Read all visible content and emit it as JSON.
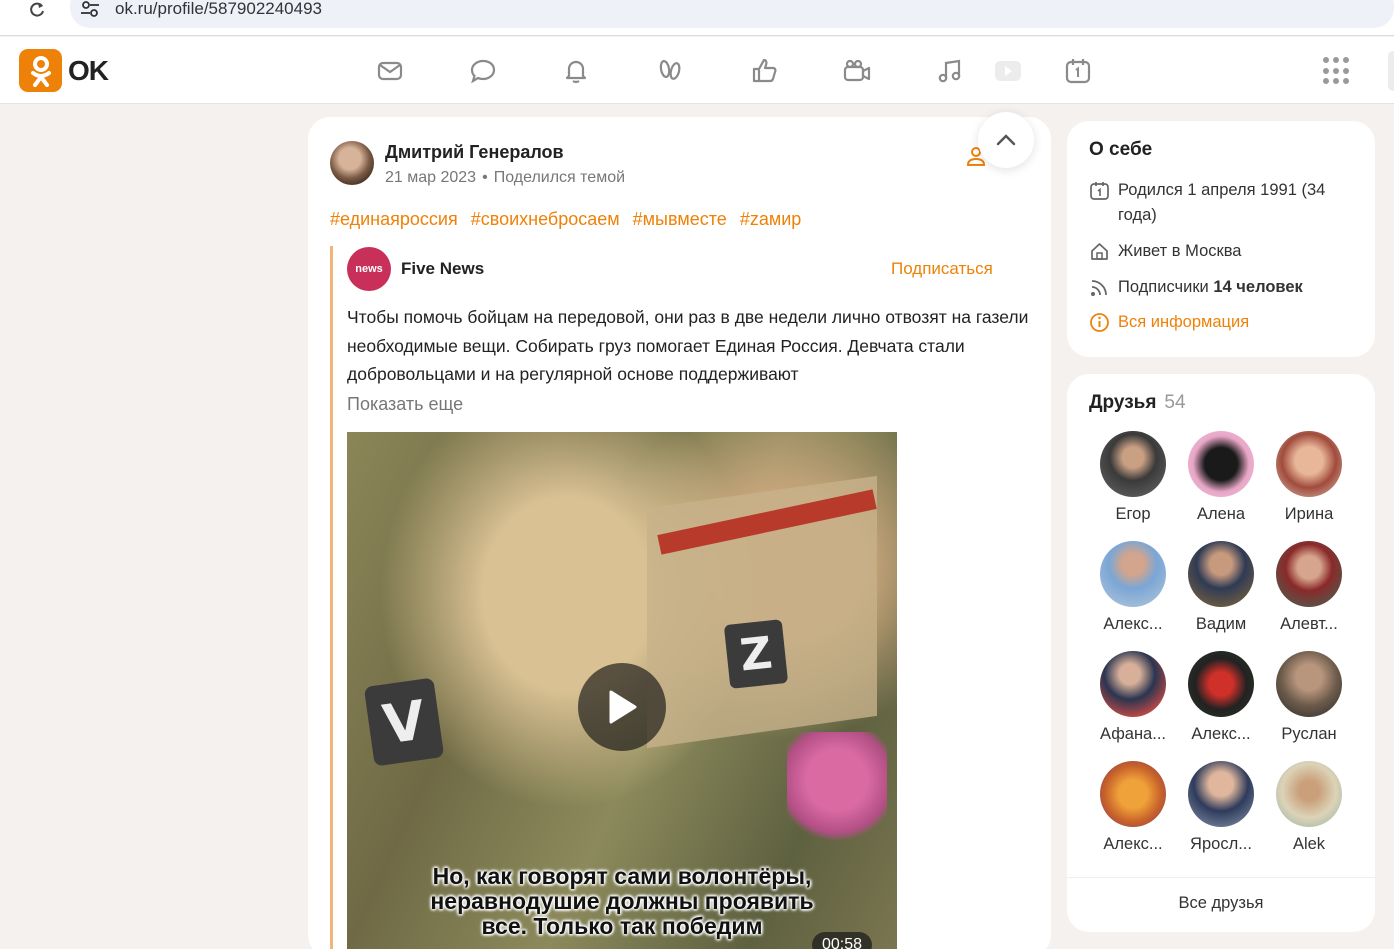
{
  "browser": {
    "url": "ok.ru/profile/587902240493"
  },
  "logo": {
    "text": "OK",
    "brand_color": "#ee8208"
  },
  "nav_icons": [
    "mail-icon",
    "chat-icon",
    "bell-icon",
    "guests-icon",
    "likes-icon",
    "video-camera-icon",
    "music-icon",
    "play-icon",
    "calendar-icon",
    "apps-grid-icon"
  ],
  "post": {
    "author": "Дмитрий Генералов",
    "date": "21 мар 2023",
    "action": "Поделился темой",
    "hashtags": [
      "#единаяроссия",
      "#своихнебросаем",
      "#мывместе",
      "#zамир"
    ],
    "repost": {
      "group_name": "Five News",
      "group_avatar_text": "news",
      "subscribe_label": "Подписаться",
      "text": "Чтобы помочь бойцам на передовой, они раз в две недели лично отвозят на газели необходимые вещи. Собирать груз помогает Единая Россия. Девчата стали добровольцами и на регулярной основе поддерживают",
      "show_more": "Показать еще",
      "video": {
        "subtitle_line1": "Но, как говорят сами волонтёры,",
        "subtitle_line2": "неравнодушие должны проявить",
        "subtitle_line3": "все. Только так победим",
        "duration": "00:58",
        "patch_v": "V",
        "patch_z": "Z"
      }
    }
  },
  "about": {
    "title": "О себе",
    "birthday": "Родился 1 апреля 1991 (34 года)",
    "city": "Живет в Москва",
    "subscribers_label": "Подписчики",
    "subscribers_value": "14 человек",
    "all_info": "Вся информация"
  },
  "friends": {
    "title": "Друзья",
    "count": "54",
    "items": [
      {
        "name": "Егор"
      },
      {
        "name": "Алена"
      },
      {
        "name": "Ирина"
      },
      {
        "name": "Алекс..."
      },
      {
        "name": "Вадим"
      },
      {
        "name": "Алевт..."
      },
      {
        "name": "Афана..."
      },
      {
        "name": "Алекс..."
      },
      {
        "name": "Руслан"
      },
      {
        "name": "Алекс..."
      },
      {
        "name": "Яросл..."
      },
      {
        "name": "Alek"
      }
    ],
    "all_label": "Все друзья"
  }
}
